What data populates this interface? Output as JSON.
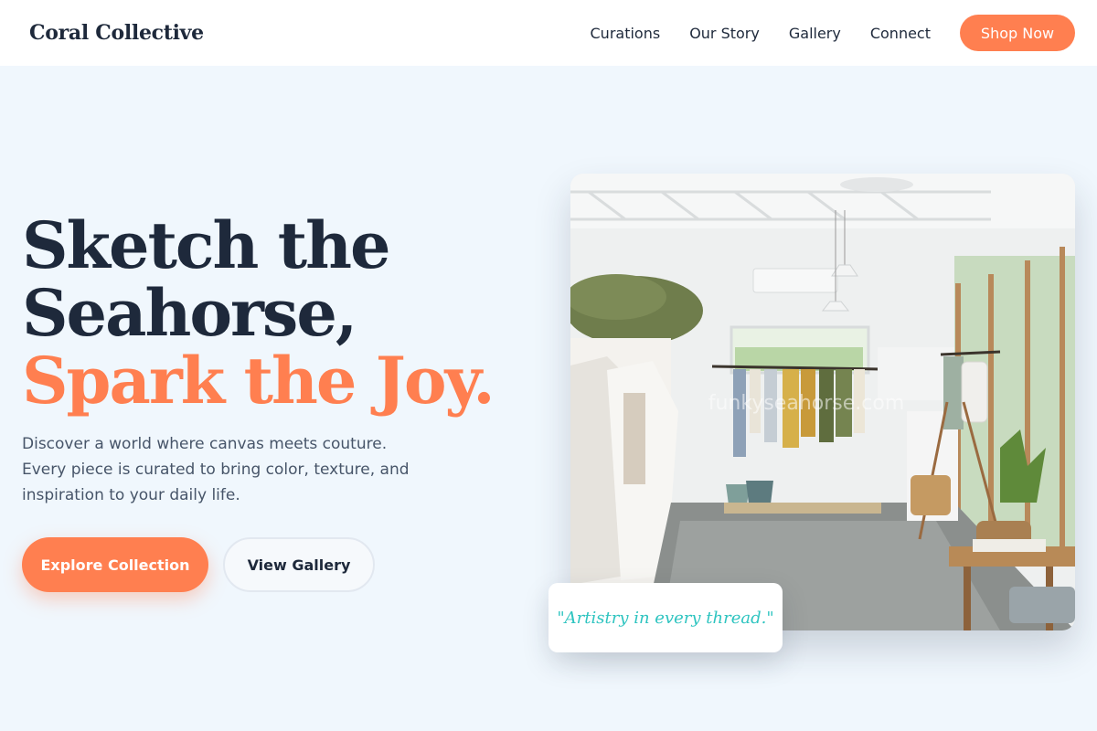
{
  "header": {
    "brand": "Coral Collective",
    "nav": [
      "Curations",
      "Our Story",
      "Gallery",
      "Connect"
    ],
    "cta": "Shop Now"
  },
  "hero": {
    "title_line1": "Sketch the",
    "title_line2": "Seahorse,",
    "title_line3": "Spark the Joy.",
    "description": "Discover a world where canvas meets couture. Every piece is curated to bring color, texture, and inspiration to your daily life.",
    "primary_button": "Explore Collection",
    "secondary_button": "View Gallery",
    "image_watermark": "funkyseahorse.com",
    "quote": "\"Artistry in every thread.\""
  },
  "colors": {
    "accent": "#ff7f50",
    "heading": "#1e293b",
    "background": "#f0f7fd",
    "quote": "#2ec4c0"
  }
}
